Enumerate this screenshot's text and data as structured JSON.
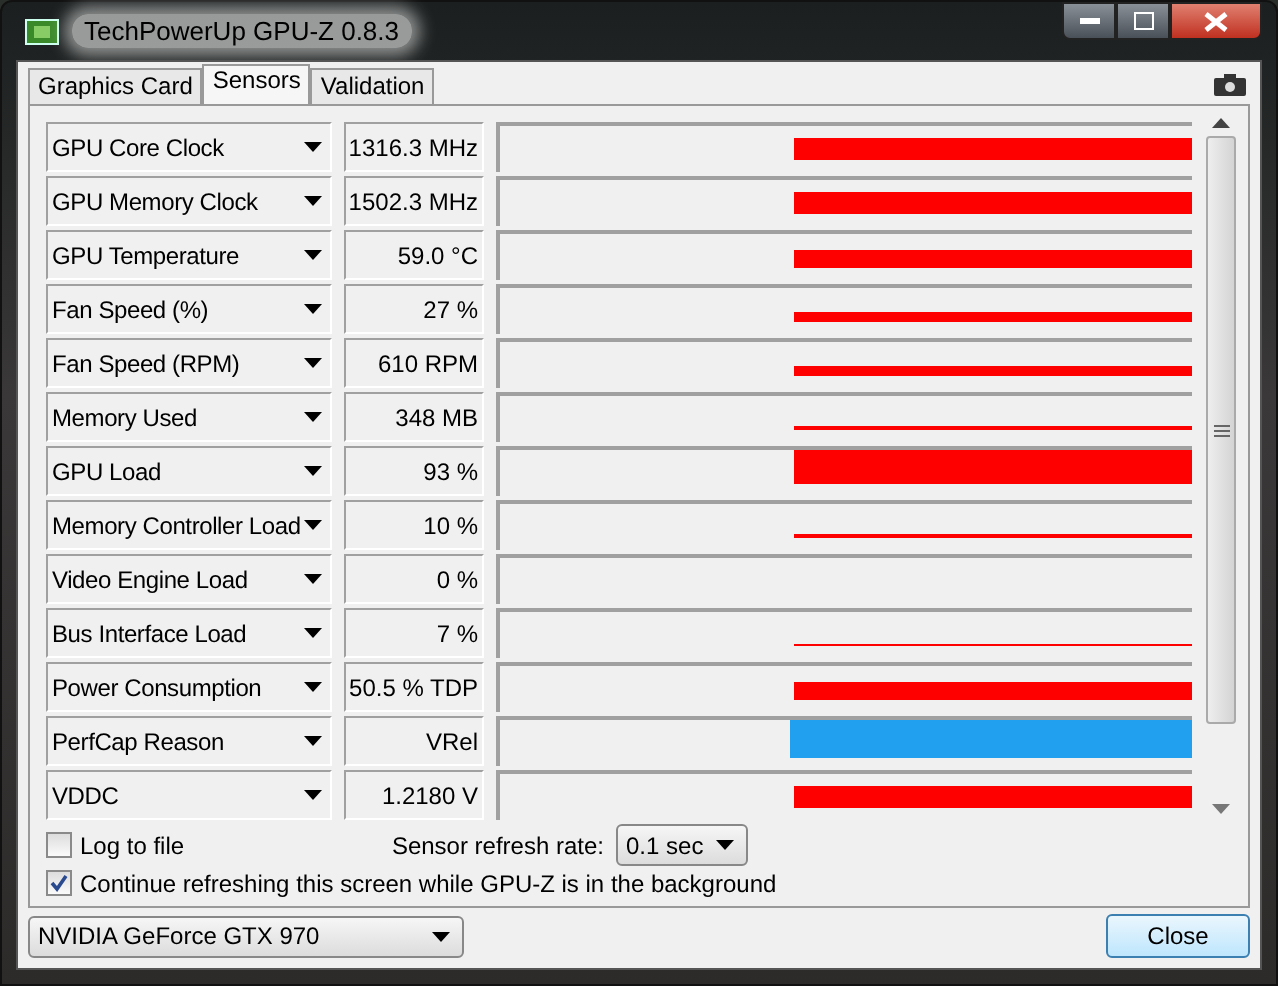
{
  "window": {
    "title": "TechPowerUp GPU-Z 0.8.3"
  },
  "tabs": [
    {
      "label": "Graphics Card",
      "selected": false
    },
    {
      "label": "Sensors",
      "selected": true
    },
    {
      "label": "Validation",
      "selected": false
    }
  ],
  "sensors": [
    {
      "name": "GPU Core Clock",
      "reading": "1316.3 MHz",
      "kind": "high",
      "color": "#ff0000"
    },
    {
      "name": "GPU Memory Clock",
      "reading": "1502.3 MHz",
      "kind": "high",
      "color": "#ff0000"
    },
    {
      "name": "GPU Temperature",
      "reading": "59.0 °C",
      "kind": "mid",
      "color": "#ff0000"
    },
    {
      "name": "Fan Speed (%)",
      "reading": "27 %",
      "kind": "low",
      "color": "#ff0000"
    },
    {
      "name": "Fan Speed (RPM)",
      "reading": "610 RPM",
      "kind": "low",
      "color": "#ff0000"
    },
    {
      "name": "Memory Used",
      "reading": "348 MB",
      "kind": "line",
      "color": "#ff0000"
    },
    {
      "name": "GPU Load",
      "reading": "93 %",
      "kind": "full",
      "color": "#ff0000"
    },
    {
      "name": "Memory Controller Load",
      "reading": "10 %",
      "kind": "line",
      "color": "#ff0000"
    },
    {
      "name": "Video Engine Load",
      "reading": "0 %",
      "kind": "empty"
    },
    {
      "name": "Bus Interface Load",
      "reading": "7 %",
      "kind": "hairline",
      "color": "#ff0000"
    },
    {
      "name": "Power Consumption",
      "reading": "50.5 % TDP",
      "kind": "mid",
      "color": "#ff0000"
    },
    {
      "name": "PerfCap Reason",
      "reading": "VRel",
      "kind": "band",
      "color": "#22a0f0"
    },
    {
      "name": "VDDC",
      "reading": "1.2180 V",
      "kind": "high",
      "color": "#ff0000"
    }
  ],
  "log_to_file": {
    "label": "Log to file",
    "checked": false
  },
  "refresh_rate": {
    "label": "Sensor refresh rate:",
    "value": "0.1 sec"
  },
  "continue_refreshing": {
    "label": "Continue refreshing this screen while GPU-Z is in the background",
    "checked": true
  },
  "gpu_select": {
    "value": "NVIDIA GeForce GTX 970"
  },
  "close_button": "Close"
}
